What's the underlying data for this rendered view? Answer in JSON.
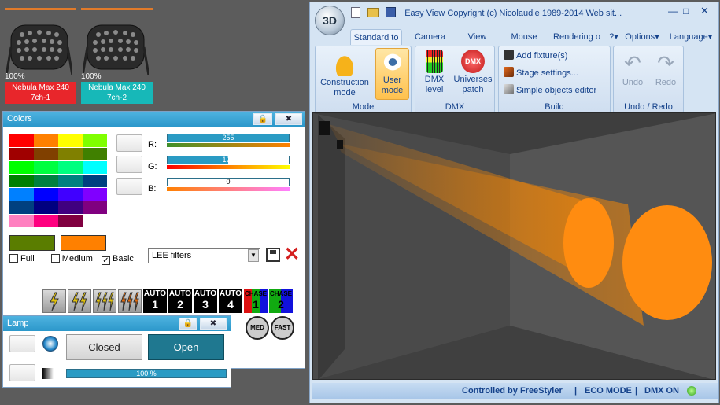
{
  "fixtures": [
    {
      "percent": "100%",
      "name": "Nebula Max 240",
      "channel": "7ch-1",
      "color": "#e8262b"
    },
    {
      "percent": "100%",
      "name": "Nebula Max 240",
      "channel": "7ch-2",
      "color": "#17b8b8"
    }
  ],
  "colors_panel": {
    "title": "Colors",
    "palette": [
      "#ff0000",
      "#ff8000",
      "#ffff00",
      "#80ff00",
      "#a00000",
      "#804000",
      "#808000",
      "#408000",
      "#00ff00",
      "#00ff40",
      "#00ff80",
      "#00ffff",
      "#008000",
      "#008040",
      "#008080",
      "#004080",
      "#0080ff",
      "#0000ff",
      "#4000ff",
      "#8000ff",
      "#004080",
      "#000080",
      "#400080",
      "#800080",
      "#ff80c0",
      "#ff0080",
      "#800040",
      "#ffffff"
    ],
    "current_color": "#5a7d00",
    "previous_color": "#ff8000",
    "r_label": "R:",
    "r_value": "255",
    "r_fraction": 1.0,
    "g_label": "G:",
    "g_value": "128",
    "g_fraction": 0.5,
    "b_label": "B:",
    "b_value": "0",
    "b_fraction": 0.0,
    "opt_full": "Full",
    "opt_medium": "Medium",
    "opt_basic": "Basic",
    "filter_value": "LEE filters",
    "auto": [
      {
        "top": "AUTO",
        "n": "1"
      },
      {
        "top": "AUTO",
        "n": "2"
      },
      {
        "top": "AUTO",
        "n": "3"
      },
      {
        "top": "AUTO",
        "n": "4"
      }
    ],
    "chase": [
      {
        "top": "CHASE",
        "n": "1"
      },
      {
        "top": "CHASE",
        "n": "2"
      }
    ],
    "speed": [
      "MED",
      "FAST"
    ]
  },
  "lamp_panel": {
    "title": "Lamp",
    "closed_label": "Closed",
    "open_label": "Open",
    "dimmer_text": "100 %",
    "dimmer_fraction": 1.0
  },
  "window": {
    "quick_title": "Easy View   Copyright (c) Nicolaudie 1989-2014   Web sit...",
    "tabs": [
      "Standard to",
      "Camera",
      "View",
      "Mouse",
      "Rendering o",
      "?",
      "Options",
      "Language"
    ],
    "mode_group": {
      "label": "Mode",
      "construction": "Construction mode",
      "user": "User mode"
    },
    "dmx_group": {
      "label": "DMX",
      "level": "DMX level",
      "patch": "Universes patch",
      "patch_icon": "DMX"
    },
    "build_group": {
      "label": "Build",
      "add": "Add fixture(s)",
      "stage": "Stage settings...",
      "simple": "Simple objects editor"
    },
    "undo_group": {
      "label": "Undo / Redo",
      "undo": "Undo",
      "redo": "Redo"
    },
    "logo": "3D"
  },
  "status": {
    "controlled": "Controlled by FreeStyler",
    "eco": "ECO MODE",
    "dmx": "DMX ON"
  }
}
